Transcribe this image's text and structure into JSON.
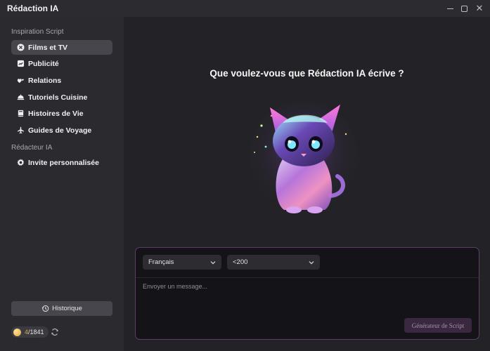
{
  "window": {
    "title": "Rédaction IA",
    "minimize_icon": "minimize-icon",
    "maximize_icon": "maximize-icon",
    "close_icon": "close-icon",
    "close_glyph": "✕"
  },
  "sidebar": {
    "section_inspiration": "Inspiration Script",
    "items": [
      {
        "label": "Films et TV",
        "icon": "film-icon",
        "active": true
      },
      {
        "label": "Publicité",
        "icon": "chart-icon",
        "active": false
      },
      {
        "label": "Relations",
        "icon": "hearts-icon",
        "active": false
      },
      {
        "label": "Tutoriels Cuisine",
        "icon": "cooking-icon",
        "active": false
      },
      {
        "label": "Histoires de Vie",
        "icon": "book-icon",
        "active": false
      },
      {
        "label": "Guides de Voyage",
        "icon": "plane-icon",
        "active": false
      }
    ],
    "section_writer": "Rédacteur IA",
    "custom_prompt": {
      "label": "Invite personnalisée",
      "icon": "gear-icon"
    },
    "history": {
      "label": "Historique",
      "icon": "history-icon"
    },
    "credits": {
      "used": "4",
      "total": "/1841",
      "icon": "coin-icon",
      "refresh_icon": "refresh-icon"
    }
  },
  "main": {
    "headline": "Que voulez-vous que Rédaction IA écrive ?",
    "mascot_icon": "cat-mascot-icon",
    "composer": {
      "language_value": "Français",
      "length_value": "<200",
      "placeholder": "Envoyer un message...",
      "generate_label": "Générateur de Script"
    }
  },
  "colors": {
    "background": "#242428",
    "sidebar": "#2a2a2f",
    "active_item": "#46464c",
    "composer_border": "#5a3f66",
    "generate_button": "#3a2840"
  }
}
